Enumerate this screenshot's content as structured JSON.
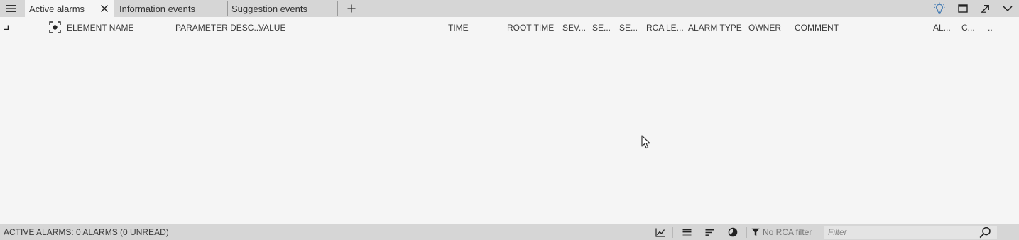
{
  "tabs": [
    {
      "label": "Active alarms",
      "active": true,
      "closable": true
    },
    {
      "label": "Information events",
      "active": false,
      "closable": false
    },
    {
      "label": "Suggestion events",
      "active": false,
      "closable": false
    }
  ],
  "toolbar_icons": [
    "menu-icon",
    "plus-icon",
    "lightbulb-icon",
    "window-icon",
    "detach-icon",
    "chevron-down-icon"
  ],
  "columns": [
    {
      "label": "ELEMENT NAME"
    },
    {
      "label": "PARAMETER DESC..."
    },
    {
      "label": "VALUE"
    },
    {
      "label": "TIME"
    },
    {
      "label": "ROOT TIME"
    },
    {
      "label": "SEV..."
    },
    {
      "label": "SE..."
    },
    {
      "label": "SE..."
    },
    {
      "label": "RCA LE..."
    },
    {
      "label": "ALARM TYPE"
    },
    {
      "label": "OWNER"
    },
    {
      "label": "COMMENT"
    },
    {
      "label": "AL..."
    },
    {
      "label": "C..."
    },
    {
      "label": ".."
    }
  ],
  "rows": [],
  "status": {
    "summary": "ACTIVE ALARMS: 0 ALARMS (0 UNREAD)",
    "rca_filter": "No RCA filter",
    "filter_placeholder": "Filter",
    "filter_value": ""
  },
  "colors": {
    "bar_background": "#d6d6d6",
    "content_background": "#f5f5f5",
    "text": "#333333",
    "lightbulb_accent": "#4a7fb5"
  }
}
